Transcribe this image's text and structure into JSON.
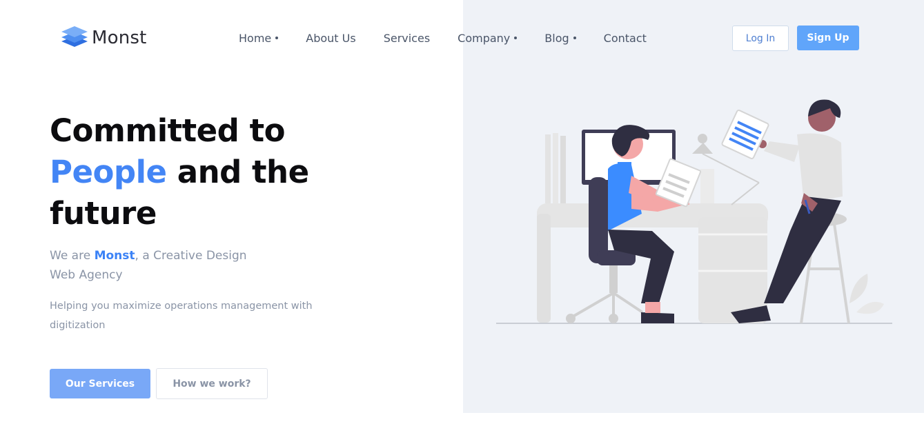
{
  "brand": {
    "name": "Monst"
  },
  "nav": {
    "items": [
      {
        "label": "Home",
        "dropdown": true
      },
      {
        "label": "About Us",
        "dropdown": false
      },
      {
        "label": "Services",
        "dropdown": false
      },
      {
        "label": "Company",
        "dropdown": true
      },
      {
        "label": "Blog",
        "dropdown": true
      },
      {
        "label": "Contact",
        "dropdown": false
      }
    ]
  },
  "auth": {
    "login_label": "Log In",
    "signup_label": "Sign Up"
  },
  "hero": {
    "title_line1": "Committed to",
    "title_accent": "People",
    "title_line2_rest": " and the",
    "title_line3": "future",
    "tagline_prefix": "We are ",
    "tagline_brand": "Monst",
    "tagline_suffix": ", a Creative Design Web Agency",
    "description": "Helping you maximize operations management with digitization",
    "primary_button": "Our Services",
    "secondary_button": "How we work?"
  },
  "colors": {
    "accent": "#4385f5",
    "button_primary": "#79a8f7",
    "signup": "#60a5fa",
    "panel_bg": "#eff2f7"
  },
  "icons": {
    "logo": "stacked-layers-icon",
    "nav_dropdown": "dot-icon"
  }
}
